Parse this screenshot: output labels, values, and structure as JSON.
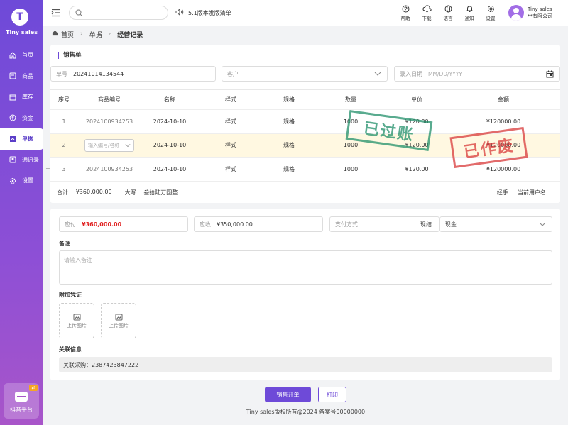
{
  "app": {
    "name": "Tiny sales",
    "logo_letter": "T"
  },
  "sidebar": {
    "items": [
      {
        "label": "首页",
        "icon": "home-icon"
      },
      {
        "label": "商品",
        "icon": "goods-icon"
      },
      {
        "label": "库存",
        "icon": "inventory-icon"
      },
      {
        "label": "资金",
        "icon": "funds-icon"
      },
      {
        "label": "单据",
        "icon": "documents-icon",
        "active": true
      },
      {
        "label": "通讯录",
        "icon": "contacts-icon"
      },
      {
        "label": "设置",
        "icon": "settings-icon"
      }
    ],
    "platform": {
      "label": "抖音平台",
      "icon": "shop-icon"
    }
  },
  "header": {
    "search_placeholder": "",
    "announcement": "5.1版本发版清单",
    "icons": [
      {
        "label": "帮助",
        "icon": "help-icon"
      },
      {
        "label": "下载",
        "icon": "download-icon"
      },
      {
        "label": "语言",
        "icon": "globe-icon"
      },
      {
        "label": "通知",
        "icon": "bell-icon"
      },
      {
        "label": "设置",
        "icon": "gear-icon"
      }
    ],
    "user": {
      "name": "Tiny sales",
      "company": "**有限公司"
    }
  },
  "breadcrumb": {
    "home": "首页",
    "level1": "单据",
    "current": "经营记录"
  },
  "form": {
    "section_title": "销售单",
    "order_no_label": "单号",
    "order_no": "20241014134544",
    "customer_placeholder": "客户",
    "date_label": "录入日期",
    "date_placeholder": "MM/DD/YYYY"
  },
  "table": {
    "headers": [
      "序号",
      "商品编号",
      "名称",
      "样式",
      "规格",
      "数量",
      "单价",
      "金额"
    ],
    "rows": [
      {
        "no": "1",
        "code": "2024100934253",
        "name": "2024-10-10",
        "style": "样式",
        "spec": "规格",
        "qty": "1000",
        "price": "¥120.00",
        "amount": "¥120000.00"
      },
      {
        "no": "2",
        "code_placeholder": "输入编号/名称",
        "name": "2024-10-10",
        "style": "样式",
        "spec": "规格",
        "qty": "1000",
        "price": "¥120.00",
        "amount": "¥120000.00"
      },
      {
        "no": "3",
        "code": "2024100934253",
        "name": "2024-10-10",
        "style": "样式",
        "spec": "规格",
        "qty": "1000",
        "price": "¥120.00",
        "amount": "¥120000.00"
      }
    ],
    "totals": {
      "label": "合计:",
      "value": "¥360,000.00",
      "words_label": "大写:",
      "words": "叁拾陆万圆整"
    },
    "handler": {
      "label": "经手:",
      "value": "当前用户名"
    }
  },
  "stamps": {
    "posted": "已过账",
    "voided": "已作废",
    "posted_color": "#22906a",
    "voided_color": "#d93a3a"
  },
  "payment": {
    "payable_label": "应付",
    "payable": "¥360,000.00",
    "receivable_label": "应收",
    "receivable": "¥350,000.00",
    "method_label": "支付方式",
    "method_value": "现结",
    "account_value": "现金"
  },
  "remark": {
    "label": "备注",
    "placeholder": "请输入备注"
  },
  "attachments": {
    "label": "附加凭证",
    "upload_label": "上传图片"
  },
  "related": {
    "label": "关联信息",
    "value": "关联采购：2387423847222"
  },
  "actions": {
    "primary": "销售开单",
    "print": "打印"
  },
  "footer": "Tiny sales版权所有@2024  备案号00000000",
  "colors": {
    "accent": "#6e4ad8",
    "danger": "#e02020"
  }
}
